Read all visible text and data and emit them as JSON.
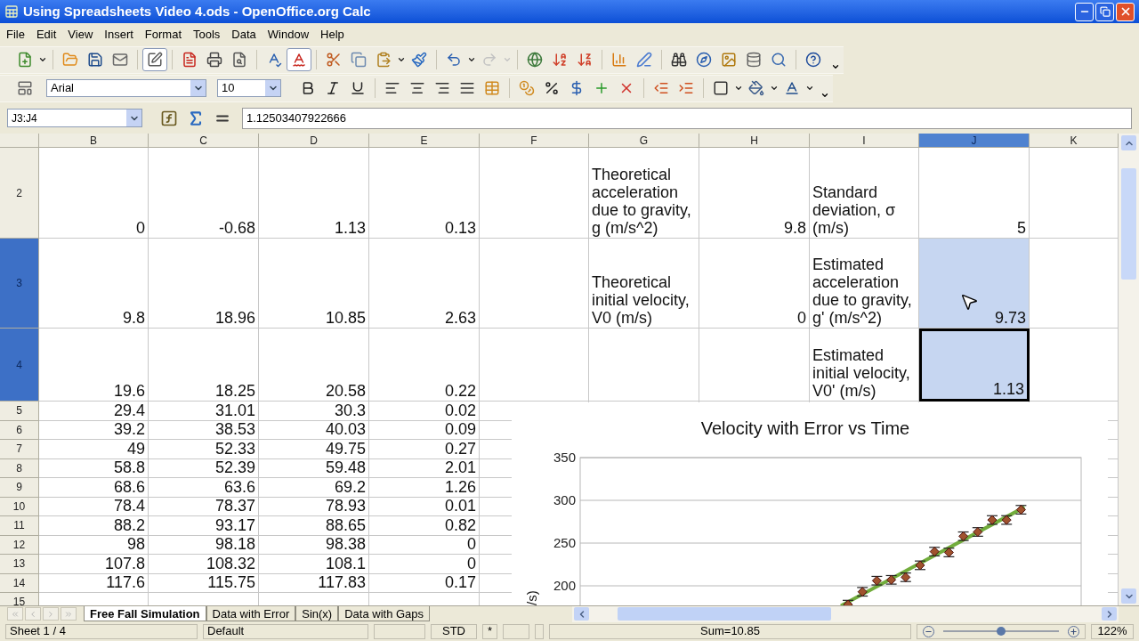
{
  "window": {
    "title": "Using Spreadsheets Video 4.ods - OpenOffice.org Calc"
  },
  "menu": [
    "File",
    "Edit",
    "View",
    "Insert",
    "Format",
    "Tools",
    "Data",
    "Window",
    "Help"
  ],
  "standard_toolbar": {
    "edit_file_on": true,
    "auto_spellcheck_on": true,
    "redo_disabled": true
  },
  "formatting_toolbar": {
    "font_name": "Arial",
    "font_size": "10"
  },
  "formula_bar": {
    "name_box": "J3:J4",
    "content": "1.12503407922666"
  },
  "sheet": {
    "columns": [
      {
        "label": "B",
        "selected": false
      },
      {
        "label": "C",
        "selected": false
      },
      {
        "label": "D",
        "selected": false
      },
      {
        "label": "E",
        "selected": false
      },
      {
        "label": "F",
        "selected": false
      },
      {
        "label": "G",
        "selected": false
      },
      {
        "label": "H",
        "selected": false
      },
      {
        "label": "I",
        "selected": false
      },
      {
        "label": "J",
        "selected": true
      },
      {
        "label": "K",
        "selected": false
      }
    ],
    "rows": [
      {
        "label": "2",
        "selected": false,
        "cells": [
          {
            "kind": "number",
            "text": "0",
            "selected": false,
            "cursor": false
          },
          {
            "kind": "number",
            "text": "-0.68",
            "selected": false,
            "cursor": false
          },
          {
            "kind": "number",
            "text": "1.13",
            "selected": false,
            "cursor": false
          },
          {
            "kind": "number",
            "text": "0.13",
            "selected": false,
            "cursor": false
          },
          {
            "selected": false,
            "cursor": false
          },
          {
            "kind": "label",
            "text": "Theoretical acceleration due to gravity, g (m/s^2)",
            "selected": false,
            "cursor": false
          },
          {
            "kind": "number",
            "text": "9.8",
            "selected": false,
            "cursor": false
          },
          {
            "kind": "label",
            "text": "Standard deviation, σ (m/s)",
            "selected": false,
            "cursor": false
          },
          {
            "kind": "number",
            "text": "5",
            "selected": false,
            "cursor": false
          },
          {
            "selected": false,
            "cursor": false
          }
        ]
      },
      {
        "label": "3",
        "selected": true,
        "cells": [
          {
            "kind": "number",
            "text": "9.8",
            "selected": false,
            "cursor": false
          },
          {
            "kind": "number",
            "text": "18.96",
            "selected": false,
            "cursor": false
          },
          {
            "kind": "number",
            "text": "10.85",
            "selected": false,
            "cursor": false
          },
          {
            "kind": "number",
            "text": "2.63",
            "selected": false,
            "cursor": false
          },
          {
            "selected": false,
            "cursor": false
          },
          {
            "kind": "label",
            "text": "Theoretical initial velocity, V0 (m/s)",
            "selected": false,
            "cursor": false
          },
          {
            "kind": "number",
            "text": "0",
            "selected": false,
            "cursor": false
          },
          {
            "kind": "label",
            "text": "Estimated acceleration due to gravity, g' (m/s^2)",
            "selected": false,
            "cursor": false
          },
          {
            "kind": "number",
            "text": "9.73",
            "selected": true,
            "cursor": false
          },
          {
            "selected": false,
            "cursor": false
          }
        ]
      },
      {
        "label": "4",
        "selected": true,
        "cells": [
          {
            "kind": "number",
            "text": "19.6",
            "selected": false,
            "cursor": false
          },
          {
            "kind": "number",
            "text": "18.25",
            "selected": false,
            "cursor": false
          },
          {
            "kind": "number",
            "text": "20.58",
            "selected": false,
            "cursor": false
          },
          {
            "kind": "number",
            "text": "0.22",
            "selected": false,
            "cursor": false
          },
          {
            "selected": false,
            "cursor": false
          },
          {
            "selected": false,
            "cursor": false
          },
          {
            "selected": false,
            "cursor": false
          },
          {
            "kind": "label",
            "text": "Estimated initial velocity, V0' (m/s)",
            "selected": false,
            "cursor": false
          },
          {
            "kind": "number",
            "text": "1.13",
            "selected": true,
            "cursor": true
          },
          {
            "selected": false,
            "cursor": false
          }
        ]
      },
      {
        "label": "5",
        "selected": false,
        "cells": [
          {
            "kind": "number",
            "text": "29.4",
            "selected": false,
            "cursor": false
          },
          {
            "kind": "number",
            "text": "31.01",
            "selected": false,
            "cursor": false
          },
          {
            "kind": "number",
            "text": "30.3",
            "selected": false,
            "cursor": false
          },
          {
            "kind": "number",
            "text": "0.02",
            "selected": false,
            "cursor": false
          },
          {
            "selected": false,
            "cursor": false
          }
        ]
      },
      {
        "label": "6",
        "selected": false,
        "cells": [
          {
            "kind": "number",
            "text": "39.2",
            "selected": false,
            "cursor": false
          },
          {
            "kind": "number",
            "text": "38.53",
            "selected": false,
            "cursor": false
          },
          {
            "kind": "number",
            "text": "40.03",
            "selected": false,
            "cursor": false
          },
          {
            "kind": "number",
            "text": "0.09",
            "selected": false,
            "cursor": false
          },
          {
            "selected": false,
            "cursor": false
          }
        ]
      },
      {
        "label": "7",
        "selected": false,
        "cells": [
          {
            "kind": "number",
            "text": "49",
            "selected": false,
            "cursor": false
          },
          {
            "kind": "number",
            "text": "52.33",
            "selected": false,
            "cursor": false
          },
          {
            "kind": "number",
            "text": "49.75",
            "selected": false,
            "cursor": false
          },
          {
            "kind": "number",
            "text": "0.27",
            "selected": false,
            "cursor": false
          },
          {
            "selected": false,
            "cursor": false
          }
        ]
      },
      {
        "label": "8",
        "selected": false,
        "cells": [
          {
            "kind": "number",
            "text": "58.8",
            "selected": false,
            "cursor": false
          },
          {
            "kind": "number",
            "text": "52.39",
            "selected": false,
            "cursor": false
          },
          {
            "kind": "number",
            "text": "59.48",
            "selected": false,
            "cursor": false
          },
          {
            "kind": "number",
            "text": "2.01",
            "selected": false,
            "cursor": false
          },
          {
            "selected": false,
            "cursor": false
          }
        ]
      },
      {
        "label": "9",
        "selected": false,
        "cells": [
          {
            "kind": "number",
            "text": "68.6",
            "selected": false,
            "cursor": false
          },
          {
            "kind": "number",
            "text": "63.6",
            "selected": false,
            "cursor": false
          },
          {
            "kind": "number",
            "text": "69.2",
            "selected": false,
            "cursor": false
          },
          {
            "kind": "number",
            "text": "1.26",
            "selected": false,
            "cursor": false
          },
          {
            "selected": false,
            "cursor": false
          }
        ]
      },
      {
        "label": "10",
        "selected": false,
        "cells": [
          {
            "kind": "number",
            "text": "78.4",
            "selected": false,
            "cursor": false
          },
          {
            "kind": "number",
            "text": "78.37",
            "selected": false,
            "cursor": false
          },
          {
            "kind": "number",
            "text": "78.93",
            "selected": false,
            "cursor": false
          },
          {
            "kind": "number",
            "text": "0.01",
            "selected": false,
            "cursor": false
          },
          {
            "selected": false,
            "cursor": false
          }
        ]
      },
      {
        "label": "11",
        "selected": false,
        "cells": [
          {
            "kind": "number",
            "text": "88.2",
            "selected": false,
            "cursor": false
          },
          {
            "kind": "number",
            "text": "93.17",
            "selected": false,
            "cursor": false
          },
          {
            "kind": "number",
            "text": "88.65",
            "selected": false,
            "cursor": false
          },
          {
            "kind": "number",
            "text": "0.82",
            "selected": false,
            "cursor": false
          },
          {
            "selected": false,
            "cursor": false
          }
        ]
      },
      {
        "label": "12",
        "selected": false,
        "cells": [
          {
            "kind": "number",
            "text": "98",
            "selected": false,
            "cursor": false
          },
          {
            "kind": "number",
            "text": "98.18",
            "selected": false,
            "cursor": false
          },
          {
            "kind": "number",
            "text": "98.38",
            "selected": false,
            "cursor": false
          },
          {
            "kind": "number",
            "text": "0",
            "selected": false,
            "cursor": false
          },
          {
            "selected": false,
            "cursor": false
          }
        ]
      },
      {
        "label": "13",
        "selected": false,
        "cells": [
          {
            "kind": "number",
            "text": "107.8",
            "selected": false,
            "cursor": false
          },
          {
            "kind": "number",
            "text": "108.32",
            "selected": false,
            "cursor": false
          },
          {
            "kind": "number",
            "text": "108.1",
            "selected": false,
            "cursor": false
          },
          {
            "kind": "number",
            "text": "0",
            "selected": false,
            "cursor": false
          },
          {
            "selected": false,
            "cursor": false
          }
        ]
      },
      {
        "label": "14",
        "selected": false,
        "cells": [
          {
            "kind": "number",
            "text": "117.6",
            "selected": false,
            "cursor": false
          },
          {
            "kind": "number",
            "text": "115.75",
            "selected": false,
            "cursor": false
          },
          {
            "kind": "number",
            "text": "117.83",
            "selected": false,
            "cursor": false
          },
          {
            "kind": "number",
            "text": "0.17",
            "selected": false,
            "cursor": false
          },
          {
            "selected": false,
            "cursor": false
          }
        ]
      },
      {
        "label": "15",
        "selected": false,
        "cells": [
          {
            "selected": false,
            "cursor": false
          },
          {
            "selected": false,
            "cursor": false
          },
          {
            "selected": false,
            "cursor": false
          },
          {
            "selected": false,
            "cursor": false
          },
          {
            "selected": false,
            "cursor": false
          }
        ]
      }
    ],
    "chart": {
      "title": "Velocity with Error vs Time",
      "ylabel": "/s)",
      "ytick_labels": [
        "350",
        "300",
        "250",
        "200"
      ]
    }
  },
  "sheet_tabs": [
    {
      "label": "Free Fall Simulation",
      "selected": true
    },
    {
      "label": "Data with Error",
      "selected": false
    },
    {
      "label": "Sin(x)",
      "selected": false
    },
    {
      "label": "Data with Gaps",
      "selected": false
    }
  ],
  "status_bar": {
    "sheet": "Sheet 1 / 4",
    "page_style": "Default",
    "mode": "STD",
    "modified": "*",
    "sum": "Sum=10.85",
    "zoom": {
      "level": 0.5,
      "reading": "122%"
    }
  }
}
